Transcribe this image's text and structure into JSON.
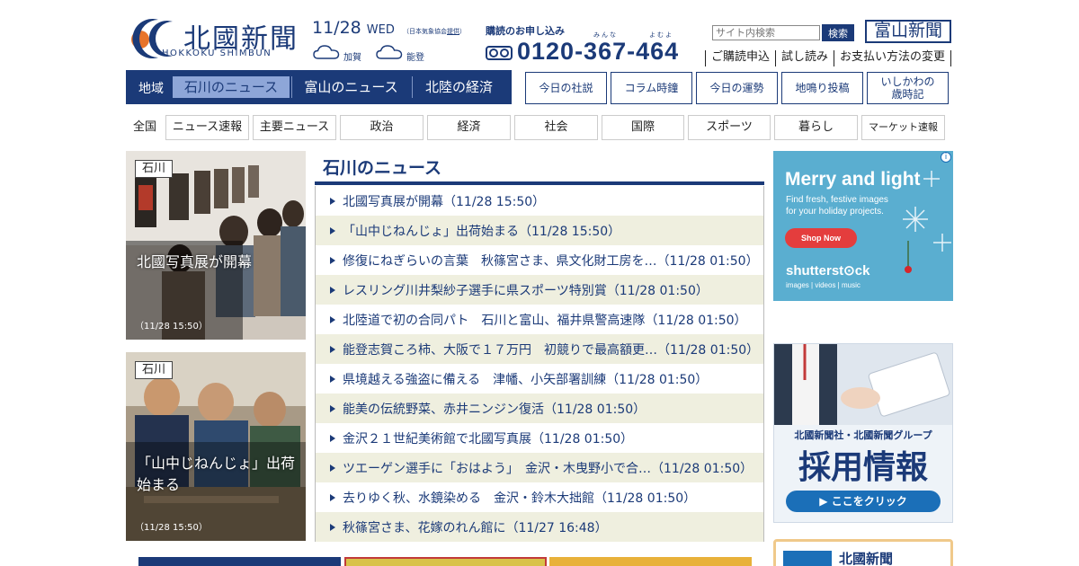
{
  "header": {
    "logo_name": "北國新聞",
    "logo_roman": "HOKKOKU SHIMBUN",
    "date": "11/28",
    "weekday": "WED",
    "jma_credit_prefix": "（日本気象協会",
    "jma_credit_link": "提供",
    "jma_credit_suffix": "）",
    "weather": [
      {
        "area": "加賀",
        "icon": "cloud-icon"
      },
      {
        "area": "能登",
        "icon": "cloud-icon"
      }
    ],
    "subscribe_title": "購読のお申し込み",
    "subscribe_ruby_1": "みんな",
    "subscribe_ruby_2": "よむよ",
    "phone_number": "0120-367-464",
    "search_placeholder": "サイト内検索",
    "search_button": "検索",
    "sister_paper": "富山新聞",
    "quick_links": [
      "ご購読申込",
      "試し読み",
      "お支払い方法の変更"
    ]
  },
  "nav": {
    "region_label": "地域",
    "region_tabs": [
      "石川のニュース",
      "富山のニュース",
      "北陸の経済"
    ],
    "column_buttons": [
      "今日の社説",
      "コラム時鐘",
      "今日の運勢",
      "地鳴り投稿",
      "いしかわの\n歳時記"
    ],
    "category_all": "全国",
    "categories": [
      "ニュース速報",
      "主要ニュース",
      "政治",
      "経済",
      "社会",
      "国際",
      "スポーツ",
      "暮らし",
      "マーケット速報"
    ]
  },
  "features": [
    {
      "tag": "石川",
      "title": "北國写真展が開幕",
      "time": "（11/28 15:50）"
    },
    {
      "tag": "石川",
      "title": "「山中じねんじょ」出荷始まる",
      "time": "（11/28 15:50）"
    }
  ],
  "news": {
    "heading": "石川のニュース",
    "items": [
      "北國写真展が開幕（11/28 15:50）",
      "「山中じねんじょ」出荷始まる（11/28 15:50）",
      "修復にねぎらいの言葉　秋篠宮さま、県文化財工房を…（11/28 01:50）",
      "レスリング川井梨紗子選手に県スポーツ特別賞（11/28 01:50）",
      "北陸道で初の合同パト　石川と富山、福井県警高速隊（11/28 01:50）",
      "能登志賀ころ柿、大阪で１７万円　初競りで最高額更…（11/28 01:50）",
      "県境越える強盗に備える　津幡、小矢部署訓練（11/28 01:50）",
      "能美の伝統野菜、赤井ニンジン復活（11/28 01:50）",
      "金沢２１世紀美術館で北國写真展（11/28 01:50）",
      "ツエーゲン選手に「おはよう」　金沢・木曳野小で合…（11/28 01:50）",
      "去りゆく秋、水鏡染める　金沢・鈴木大拙館（11/28 01:50）",
      "秋篠宮さま、花嫁のれん館に（11/27 16:48）"
    ]
  },
  "ads": {
    "shutterstock": {
      "headline": "Merry and light",
      "subtext": "Find fresh, festive images for your holiday projects.",
      "button": "Shop Now",
      "brand": "shutterst⊙ck",
      "tagline": "images  |  videos  |  music",
      "info": "i"
    },
    "recruit": {
      "org": "北國新聞社・北國新聞グループ",
      "title": "採用情報",
      "button": "▶ ここをクリック"
    },
    "bottom_right": {
      "text": "北國新聞"
    }
  },
  "colors": {
    "brand_navy": "#1b3a78",
    "active_tab": "#8ea6d8",
    "list_alt_row": "#efefdf",
    "ad_blue": "#5aaed0"
  }
}
